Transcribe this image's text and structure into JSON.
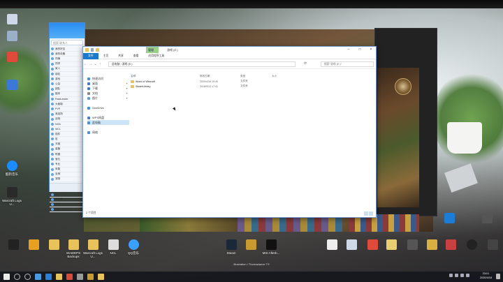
{
  "desktop": {
    "left_icons": [
      {
        "name": "computer-icon",
        "label": "",
        "color": "#cfd8e6"
      },
      {
        "name": "recycle-bin-icon",
        "label": "",
        "color": "#9ab0c8"
      },
      {
        "name": "app-icon",
        "label": "",
        "color": "#e04a3a"
      },
      {
        "name": "app-icon",
        "label": "",
        "color": "#3b78d8"
      },
      {
        "name": "kugou-icon",
        "label": "酷狗音乐",
        "color": "#1a8cff"
      },
      {
        "name": "warcraft-logs-icon",
        "label": "Warcraft Logs U...",
        "color": "#2a2a2a"
      }
    ],
    "dock_icons": [
      {
        "name": "app-icon",
        "label": "",
        "color": "#222"
      },
      {
        "name": "app-icon",
        "label": "",
        "color": "#e8a020"
      },
      {
        "name": "folder-icon",
        "label": "",
        "color": "#e8c25a"
      },
      {
        "name": "folder-icon",
        "label": "WoWDPS Backups",
        "color": "#e8c25a"
      },
      {
        "name": "folder-icon",
        "label": "Warcraft Logs U...",
        "color": "#e8c25a"
      },
      {
        "name": "file-icon",
        "label": "NCL",
        "color": "#dddddd"
      },
      {
        "name": "qq-music-icon",
        "label": "QQ音乐",
        "color": "#3aa0ff"
      },
      {
        "name": "steam-icon",
        "label": "Steam",
        "color": "#1b2838"
      },
      {
        "name": "wow-icon",
        "label": "",
        "color": "#c89a30"
      },
      {
        "name": "msi-afterburner-icon",
        "label": "MSI Afterb...",
        "color": "#111"
      },
      {
        "name": "file-icon",
        "label": "",
        "color": "#eeeeee"
      },
      {
        "name": "file-icon",
        "label": "",
        "color": "#cfd8e6"
      },
      {
        "name": "app-icon",
        "label": "",
        "color": "#e04a3a"
      },
      {
        "name": "file-icon",
        "label": "",
        "color": "#e8d070"
      },
      {
        "name": "app-icon",
        "label": "",
        "color": "#555"
      },
      {
        "name": "app-icon",
        "label": "",
        "color": "#d8b040"
      },
      {
        "name": "app-icon",
        "label": "",
        "color": "#c84040"
      },
      {
        "name": "obs-icon",
        "label": "",
        "color": "#222"
      },
      {
        "name": "app-icon",
        "label": "",
        "color": "#444"
      }
    ],
    "right_icons": [
      {
        "name": "teamviewer-icon",
        "label": "",
        "color": "#1c7cd6"
      },
      {
        "name": "app-icon",
        "label": "",
        "color": "#555"
      }
    ],
    "banner_text": "Illustration / Thornadance TS"
  },
  "qq_window": {
    "search_placeholder": "搜索:联系人",
    "contacts": [
      "我的好友",
      "我的设备",
      "同事",
      "同学",
      "家人",
      "朋友",
      "游戏",
      "公会",
      "团队",
      "副本",
      "RaidLeader",
      "大秘境",
      "PVP",
      "竞技场",
      "战场",
      "NGA",
      "WCL",
      "插件",
      "宏",
      "天赋",
      "装备",
      "附魔",
      "宝石",
      "专业",
      "采集",
      "坐骑",
      "宠物",
      "成就",
      "幻化",
      "陌生人",
      "黑名单",
      "其他",
      "分组"
    ]
  },
  "explorer": {
    "ribbon_tools_tab": "管理",
    "window_title": "游戏 (E:)",
    "tabs": [
      "文件",
      "主页",
      "共享",
      "查看",
      "应用程序工具"
    ],
    "address": "此电脑 › 游戏 (E:)",
    "search_placeholder": "搜索\"游戏 (E:)\"",
    "nav_items": [
      {
        "label": "快速访问",
        "pin": "",
        "color": "#4a90d9"
      },
      {
        "label": "桌面",
        "pin": "✦",
        "color": "#3b7bd4"
      },
      {
        "label": "下载",
        "pin": "✦",
        "color": "#3b7bd4"
      },
      {
        "label": "文档",
        "pin": "✦",
        "color": "#888"
      },
      {
        "label": "图片",
        "pin": "✦",
        "color": "#5aa0d8"
      },
      {
        "label": "",
        "pin": "",
        "color": "transparent"
      },
      {
        "label": "OneDrive",
        "pin": "",
        "color": "#3b8ed8"
      },
      {
        "label": "",
        "pin": "",
        "color": "transparent"
      },
      {
        "label": "WPS网盘",
        "pin": "",
        "color": "#4a7ad8"
      },
      {
        "label": "此电脑",
        "pin": "",
        "color": "#4a90d9"
      },
      {
        "label": "",
        "pin": "",
        "color": "transparent"
      },
      {
        "label": "网络",
        "pin": "",
        "color": "#4a90d9"
      }
    ],
    "columns": {
      "name": "名称",
      "date": "修改日期",
      "type": "类型",
      "size": "大小"
    },
    "files": [
      {
        "name": "World of Warcraft",
        "date": "2020/4/16 19:40",
        "type": "文件夹",
        "size": ""
      },
      {
        "name": "SteamLibrary",
        "date": "2018/9/12 17:41",
        "type": "文件夹",
        "size": ""
      }
    ],
    "status": "2 个项目"
  },
  "taskbar": {
    "icons": [
      {
        "name": "start-icon",
        "color": "#eaeaea"
      },
      {
        "name": "search-icon",
        "color": "#bbbbbb"
      },
      {
        "name": "task-view-icon",
        "color": "#bbbbbb"
      },
      {
        "name": "app-icon",
        "color": "#4a9ae0"
      },
      {
        "name": "edge-icon",
        "color": "#2a7fd8"
      },
      {
        "name": "explorer-icon",
        "color": "#e8c25a"
      },
      {
        "name": "app-icon",
        "color": "#d84a3a"
      },
      {
        "name": "app-icon",
        "color": "#999"
      },
      {
        "name": "app-icon",
        "color": "#c89a30"
      },
      {
        "name": "app-icon",
        "color": "#e8c25a"
      }
    ],
    "time": "23:01",
    "date": "2020/4/18"
  }
}
